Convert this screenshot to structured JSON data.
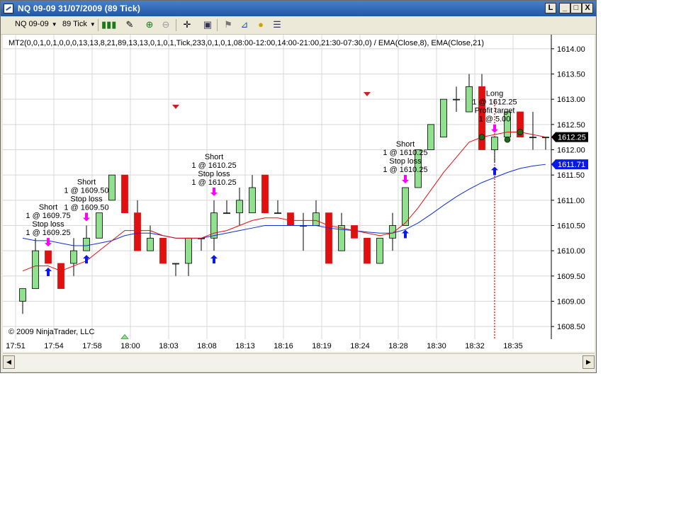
{
  "window": {
    "title": "NQ 09-09  31/07/2009 (89 Tick)",
    "buttons": [
      "L",
      "_",
      "□",
      "X"
    ]
  },
  "toolbar": {
    "instrument": "NQ 09-09",
    "interval": "89 Tick",
    "icons": [
      "candlestick-chart-icon",
      "pencil-icon",
      "zoom-in-icon",
      "zoom-out-icon",
      "crosshair-icon",
      "data-box-icon",
      "strategy-icon",
      "indicator-icon",
      "order-icon",
      "properties-icon"
    ]
  },
  "chart": {
    "strategy_label": "MT2(0,0,1,0,1,0,0,0,13,13,8,21,89,13,13,0,1,0,1,Tick,233,0,1,0,1,08:00-12:00,14:00-21:00,21:30-07:30,0) / EMA(Close,8), EMA(Close,21)",
    "copyright": "© 2009 NinjaTrader, LLC",
    "last_price_label": "1612.25",
    "ema21_price_label": "1611.71"
  },
  "colors": {
    "up_candle": "#90e090",
    "down_candle": "#e01010",
    "ema_fast": "#e01010",
    "ema_slow": "#1030d0",
    "entry_arrow_short": "#ff00ff",
    "entry_arrow_long": "#0a1ae0",
    "last_price_bg": "#000000",
    "ema21_bg": "#0a1ae0"
  },
  "chart_data": {
    "type": "candlestick",
    "ylim": [
      1608.25,
      1614.25
    ],
    "y_ticks": [
      "1614.00",
      "1613.50",
      "1613.00",
      "1612.50",
      "1612.00",
      "1611.50",
      "1611.00",
      "1610.50",
      "1610.00",
      "1609.50",
      "1609.00",
      "1608.50"
    ],
    "x_ticks": [
      "17:51",
      "17:54",
      "17:58",
      "18:00",
      "18:03",
      "18:08",
      "18:13",
      "18:16",
      "18:19",
      "18:24",
      "18:28",
      "18:30",
      "18:32",
      "18:35"
    ],
    "x_tick_bars": [
      0,
      3,
      6,
      9,
      12,
      15,
      18,
      21,
      24,
      27,
      30,
      33,
      36,
      39
    ],
    "candles": [
      {
        "o": 1609.0,
        "h": 1609.25,
        "l": 1608.75,
        "c": 1609.25
      },
      {
        "o": 1609.25,
        "h": 1610.25,
        "l": 1609.25,
        "c": 1610.0
      },
      {
        "o": 1610.0,
        "h": 1610.0,
        "l": 1609.75,
        "c": 1609.75
      },
      {
        "o": 1609.75,
        "h": 1609.75,
        "l": 1609.25,
        "c": 1609.25
      },
      {
        "o": 1609.75,
        "h": 1610.25,
        "l": 1609.5,
        "c": 1610.0
      },
      {
        "o": 1610.0,
        "h": 1610.5,
        "l": 1610.0,
        "c": 1610.25
      },
      {
        "o": 1610.25,
        "h": 1610.75,
        "l": 1610.25,
        "c": 1610.75
      },
      {
        "o": 1611.0,
        "h": 1611.5,
        "l": 1611.0,
        "c": 1611.5
      },
      {
        "o": 1611.5,
        "h": 1611.5,
        "l": 1610.75,
        "c": 1610.75
      },
      {
        "o": 1610.75,
        "h": 1611.0,
        "l": 1610.0,
        "c": 1610.0
      },
      {
        "o": 1610.0,
        "h": 1610.5,
        "l": 1610.0,
        "c": 1610.25
      },
      {
        "o": 1610.25,
        "h": 1610.25,
        "l": 1609.75,
        "c": 1609.75
      },
      {
        "o": 1609.75,
        "h": 1609.75,
        "l": 1609.5,
        "c": 1609.75
      },
      {
        "o": 1609.75,
        "h": 1610.25,
        "l": 1609.5,
        "c": 1610.25
      },
      {
        "o": 1610.25,
        "h": 1610.25,
        "l": 1610.0,
        "c": 1610.25
      },
      {
        "o": 1610.25,
        "h": 1611.0,
        "l": 1610.0,
        "c": 1610.75
      },
      {
        "o": 1610.75,
        "h": 1611.0,
        "l": 1610.75,
        "c": 1610.75
      },
      {
        "o": 1610.75,
        "h": 1611.25,
        "l": 1610.5,
        "c": 1611.0
      },
      {
        "o": 1610.75,
        "h": 1611.5,
        "l": 1610.75,
        "c": 1611.25
      },
      {
        "o": 1611.5,
        "h": 1611.5,
        "l": 1610.75,
        "c": 1610.75
      },
      {
        "o": 1610.75,
        "h": 1611.0,
        "l": 1610.75,
        "c": 1610.75
      },
      {
        "o": 1610.75,
        "h": 1610.75,
        "l": 1610.5,
        "c": 1610.5
      },
      {
        "o": 1610.5,
        "h": 1610.75,
        "l": 1610.0,
        "c": 1610.5
      },
      {
        "o": 1610.5,
        "h": 1611.0,
        "l": 1610.5,
        "c": 1610.75
      },
      {
        "o": 1610.75,
        "h": 1610.75,
        "l": 1609.75,
        "c": 1609.75
      },
      {
        "o": 1610.0,
        "h": 1610.75,
        "l": 1610.0,
        "c": 1610.5
      },
      {
        "o": 1610.5,
        "h": 1610.5,
        "l": 1610.25,
        "c": 1610.25
      },
      {
        "o": 1610.25,
        "h": 1610.25,
        "l": 1609.75,
        "c": 1609.75
      },
      {
        "o": 1609.75,
        "h": 1610.25,
        "l": 1609.75,
        "c": 1610.25
      },
      {
        "o": 1610.25,
        "h": 1610.75,
        "l": 1610.0,
        "c": 1610.5
      },
      {
        "o": 1610.5,
        "h": 1611.25,
        "l": 1610.5,
        "c": 1611.25
      },
      {
        "o": 1611.25,
        "h": 1612.0,
        "l": 1611.25,
        "c": 1612.0
      },
      {
        "o": 1612.0,
        "h": 1612.5,
        "l": 1612.0,
        "c": 1612.5
      },
      {
        "o": 1612.25,
        "h": 1613.0,
        "l": 1612.25,
        "c": 1613.0
      },
      {
        "o": 1613.0,
        "h": 1613.25,
        "l": 1612.75,
        "c": 1613.0
      },
      {
        "o": 1612.75,
        "h": 1613.5,
        "l": 1612.75,
        "c": 1613.25
      },
      {
        "o": 1613.25,
        "h": 1613.5,
        "l": 1612.0,
        "c": 1612.0
      },
      {
        "o": 1612.0,
        "h": 1612.25,
        "l": 1611.75,
        "c": 1612.25
      },
      {
        "o": 1612.25,
        "h": 1612.75,
        "l": 1612.25,
        "c": 1612.75
      },
      {
        "o": 1612.75,
        "h": 1612.75,
        "l": 1612.25,
        "c": 1612.25
      },
      {
        "o": 1612.25,
        "h": 1612.75,
        "l": 1612.0,
        "c": 1612.25
      },
      {
        "o": 1612.25,
        "h": 1612.25,
        "l": 1612.0,
        "c": 1612.25
      }
    ],
    "ema8": [
      1609.6,
      1609.7,
      1609.7,
      1609.6,
      1609.7,
      1609.8,
      1610.0,
      1610.2,
      1610.4,
      1610.4,
      1610.4,
      1610.3,
      1610.25,
      1610.25,
      1610.25,
      1610.35,
      1610.4,
      1610.5,
      1610.6,
      1610.65,
      1610.65,
      1610.6,
      1610.6,
      1610.6,
      1610.5,
      1610.45,
      1610.4,
      1610.35,
      1610.3,
      1610.35,
      1610.55,
      1610.85,
      1611.2,
      1611.55,
      1611.85,
      1612.15,
      1612.25,
      1612.3,
      1612.35,
      1612.35,
      1612.3,
      1612.25
    ],
    "ema21": [
      1610.25,
      1610.2,
      1610.2,
      1610.15,
      1610.1,
      1610.1,
      1610.15,
      1610.2,
      1610.3,
      1610.35,
      1610.35,
      1610.3,
      1610.25,
      1610.25,
      1610.25,
      1610.3,
      1610.35,
      1610.4,
      1610.45,
      1610.5,
      1610.5,
      1610.5,
      1610.5,
      1610.5,
      1610.45,
      1610.42,
      1610.4,
      1610.37,
      1610.35,
      1610.35,
      1610.42,
      1610.55,
      1610.72,
      1610.9,
      1611.07,
      1611.22,
      1611.35,
      1611.45,
      1611.55,
      1611.63,
      1611.68,
      1611.71
    ],
    "trades": [
      {
        "bar": 2,
        "dir": "short",
        "lines": [
          "Short",
          "1 @ 1609.75",
          "Stop loss",
          "1 @ 1609.25"
        ]
      },
      {
        "bar": 5,
        "dir": "short",
        "lines": [
          "Short",
          "1 @ 1609.50",
          "Stop loss",
          "1 @ 1609.50"
        ]
      },
      {
        "bar": 15,
        "dir": "short",
        "lines": [
          "Short",
          "1 @ 1610.25",
          "Stop loss",
          "1 @ 1610.25"
        ]
      },
      {
        "bar": 30,
        "dir": "short",
        "lines": [
          "Short",
          "1 @ 1610.25",
          "Stop loss",
          "1 @ 1610.25"
        ]
      },
      {
        "bar": 37,
        "dir": "long",
        "lines": [
          "Long",
          "1 @ 1612.25",
          "Profit target",
          "1 @ 5.00"
        ]
      }
    ],
    "long_arrows_bars": [
      2,
      5,
      15,
      30,
      37
    ],
    "short_arrows_bars": [
      2,
      5,
      15,
      30,
      37
    ],
    "signal_triangles_down": [
      {
        "bar": 12,
        "price": 1612.85
      },
      {
        "bar": 27,
        "price": 1613.1
      }
    ],
    "signal_triangles_up": [
      {
        "bar": 8,
        "price": 1608.3
      }
    ],
    "dots": [
      {
        "bar": 36,
        "price": 1612.25
      },
      {
        "bar": 38,
        "price": 1612.2
      },
      {
        "bar": 39,
        "price": 1612.35
      }
    ],
    "exit_line_bar": 37
  }
}
